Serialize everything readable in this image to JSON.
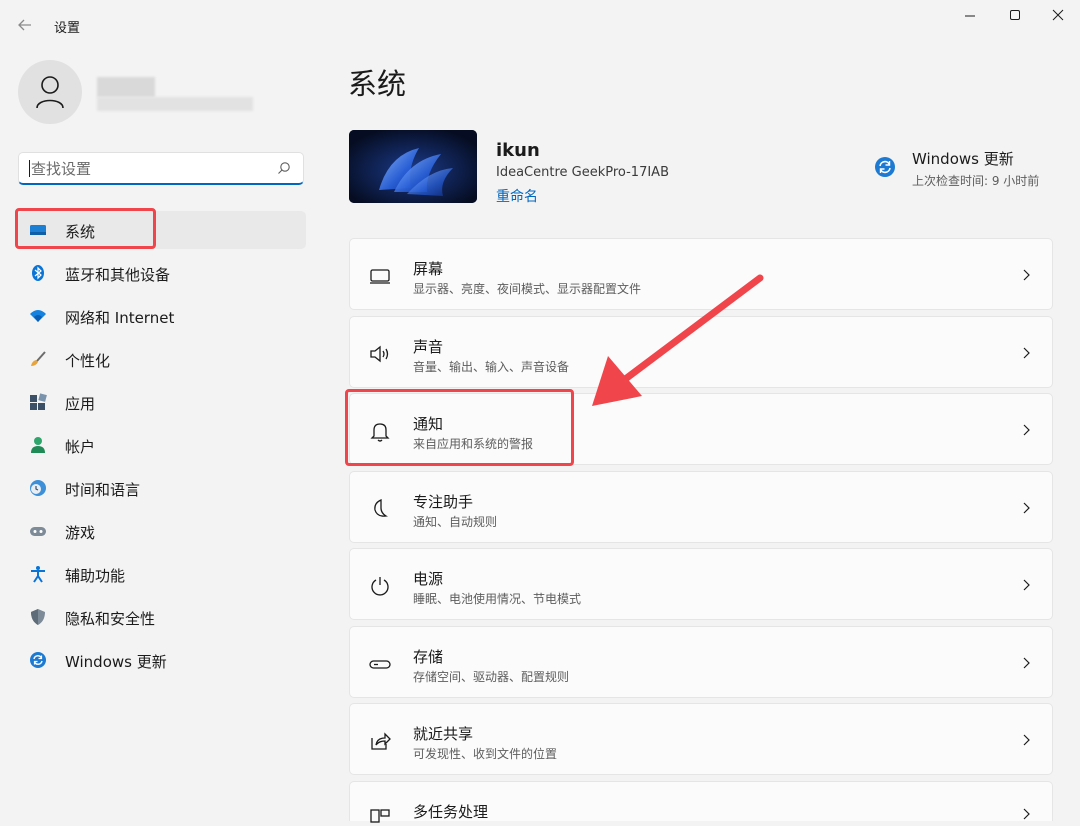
{
  "app": {
    "title": "设置"
  },
  "sidebar": {
    "search_placeholder": "查找设置",
    "items": [
      {
        "label": "系统",
        "icon": "display-icon",
        "selected": true
      },
      {
        "label": "蓝牙和其他设备",
        "icon": "bluetooth-icon"
      },
      {
        "label": "网络和 Internet",
        "icon": "wifi-icon"
      },
      {
        "label": "个性化",
        "icon": "brush-icon"
      },
      {
        "label": "应用",
        "icon": "apps-icon"
      },
      {
        "label": "帐户",
        "icon": "account-icon"
      },
      {
        "label": "时间和语言",
        "icon": "clock-globe-icon"
      },
      {
        "label": "游戏",
        "icon": "gamepad-icon"
      },
      {
        "label": "辅助功能",
        "icon": "accessibility-icon"
      },
      {
        "label": "隐私和安全性",
        "icon": "shield-icon"
      },
      {
        "label": "Windows 更新",
        "icon": "update-icon"
      }
    ]
  },
  "main": {
    "title": "系统",
    "device": {
      "name": "ikun",
      "model": "IdeaCentre GeekPro-17IAB",
      "rename": "重命名"
    },
    "update": {
      "title": "Windows 更新",
      "subtitle": "上次检查时间: 9 小时前"
    },
    "cards": [
      {
        "title": "屏幕",
        "subtitle": "显示器、亮度、夜间模式、显示器配置文件",
        "icon": "monitor-icon"
      },
      {
        "title": "声音",
        "subtitle": "音量、输出、输入、声音设备",
        "icon": "speaker-icon"
      },
      {
        "title": "通知",
        "subtitle": "来自应用和系统的警报",
        "icon": "bell-icon"
      },
      {
        "title": "专注助手",
        "subtitle": "通知、自动规则",
        "icon": "moon-icon"
      },
      {
        "title": "电源",
        "subtitle": "睡眠、电池使用情况、节电模式",
        "icon": "power-icon"
      },
      {
        "title": "存储",
        "subtitle": "存储空间、驱动器、配置规则",
        "icon": "drive-icon"
      },
      {
        "title": "就近共享",
        "subtitle": "可发现性、收到文件的位置",
        "icon": "share-icon"
      },
      {
        "title": "多任务处理",
        "subtitle": "",
        "icon": "multitask-icon"
      }
    ]
  },
  "colors": {
    "accent": "#0067c0",
    "annotation": "#f0454a",
    "background": "#f3f3f3"
  }
}
